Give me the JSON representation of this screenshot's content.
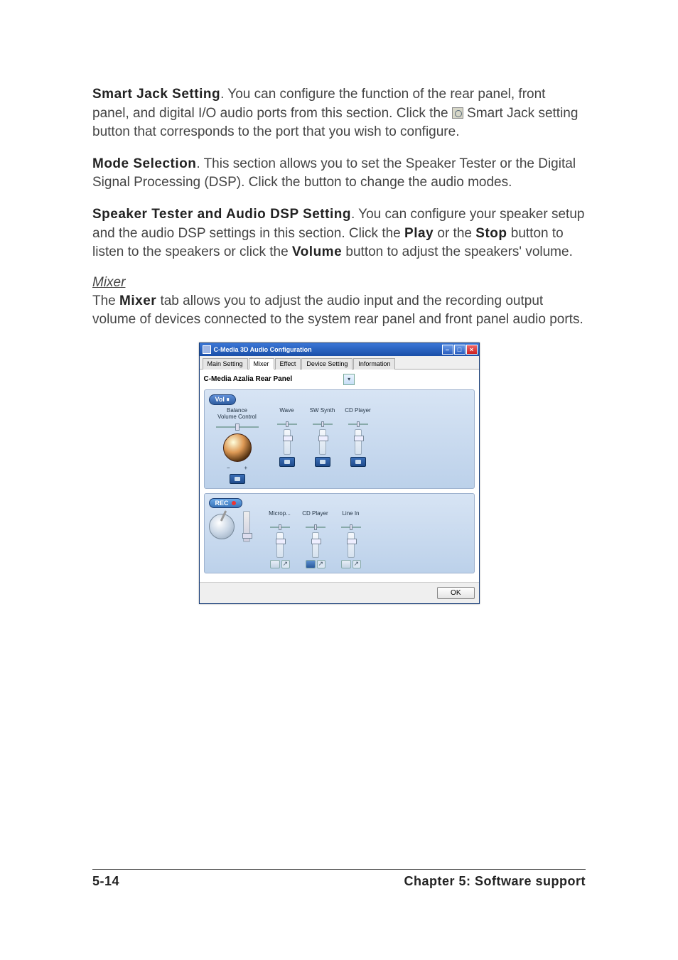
{
  "paragraphs": {
    "p1_bold": "Smart Jack Setting",
    "p1_rest_a": ". You can configure the function of the rear panel, front panel, and digital I/O audio ports from this section. Click the ",
    "p1_rest_b": " Smart Jack setting button that corresponds to the port that you wish to configure.",
    "p2_bold": "Mode Selection",
    "p2_rest": ". This section allows you to set the Speaker Tester or the Digital Signal Processing (DSP). Click the button to change the audio modes.",
    "p3_bold": "Speaker Tester and Audio DSP Setting",
    "p3_rest_a": ". You can configure your speaker setup and the audio DSP settings in this section. Click the ",
    "p3_play": "Play",
    "p3_rest_b": " or the ",
    "p3_stop": "Stop",
    "p3_rest_c": " button to listen to the speakers or click the ",
    "p3_volume": "Volume",
    "p3_rest_d": " button to adjust the speakers' volume.",
    "mixer_heading": "Mixer",
    "mixer_a": "The ",
    "mixer_bold": "Mixer",
    "mixer_b": " tab allows you to adjust the audio input and the recording output volume of devices connected to the system rear panel and front panel audio ports."
  },
  "app": {
    "title": "C-Media 3D Audio Configuration",
    "tabs": [
      "Main Setting",
      "Mixer",
      "Effect",
      "Device Setting",
      "Information"
    ],
    "active_tab_index": 1,
    "device_label": "C-Media Azalia Rear Panel",
    "ok_label": "OK",
    "vol_section": {
      "pill": "Vol",
      "balance_label_1": "Balance",
      "balance_label_2": "Volume Control",
      "channels": [
        "Wave",
        "SW Synth",
        "CD Player"
      ]
    },
    "rec_section": {
      "pill": "REC",
      "channels": [
        "Microp...",
        "CD Player",
        "Line In"
      ]
    }
  },
  "footer": {
    "left": "5-14",
    "right": "Chapter 5: Software support"
  }
}
